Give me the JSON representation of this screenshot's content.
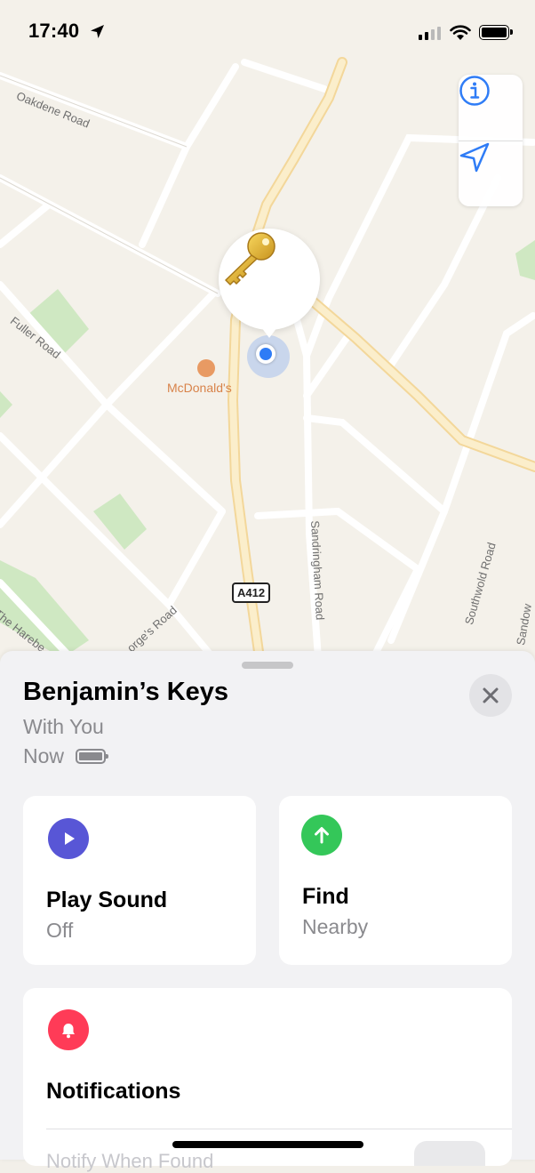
{
  "status_bar": {
    "time": "17:40"
  },
  "map": {
    "labels": {
      "oakdene": "Oakdene Road",
      "fuller": "Fuller Road",
      "mcdonalds": "McDonald's",
      "sandringham": "Sandringham Road",
      "southwold": "Southwold Road",
      "a412": "A412",
      "harebell": "The Harebe",
      "georges": "orge's Road",
      "sandown": "Sandow"
    },
    "controls": {
      "info_icon": "info-icon",
      "location_icon": "location-arrow-icon"
    },
    "pin_icon": "key-icon"
  },
  "item": {
    "name": "Benjamin’s Keys",
    "status": "With You",
    "time": "Now"
  },
  "actions": {
    "play_sound": {
      "label": "Play Sound",
      "sub": "Off",
      "color": "#5856d6"
    },
    "find": {
      "label": "Find",
      "sub": "Nearby",
      "color": "#34c759"
    }
  },
  "notifications": {
    "label": "Notifications",
    "color": "#ff3b57",
    "partial_row": "Notify When Found"
  }
}
